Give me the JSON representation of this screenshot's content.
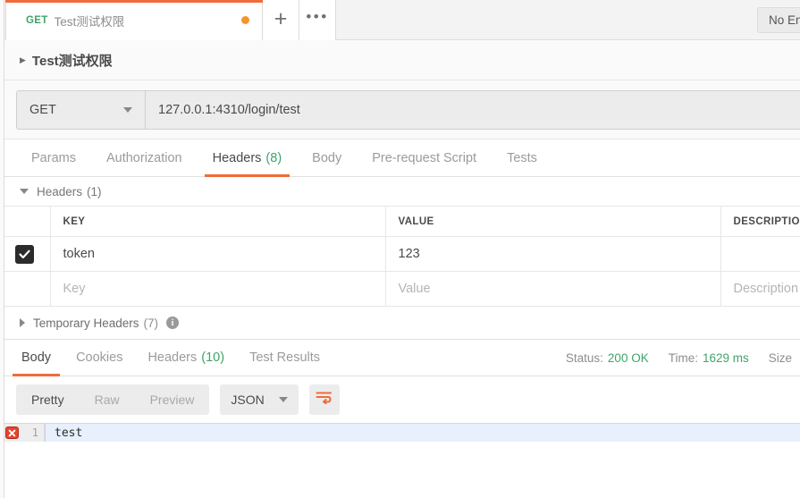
{
  "tabstrip": {
    "tab": {
      "method": "GET",
      "title": "Test测试权限",
      "unsaved_dot": "unsaved-indicator"
    },
    "new_tab_label": "+",
    "more_label": "•••",
    "environment": "No Environment"
  },
  "breadcrumb": {
    "caret": "▶",
    "title": "Test测试权限"
  },
  "request": {
    "method": "GET",
    "url": "127.0.0.1:4310/login/test",
    "tabs": [
      {
        "label": "Params",
        "count": "",
        "active": false
      },
      {
        "label": "Authorization",
        "count": "",
        "active": false
      },
      {
        "label": "Headers",
        "count": "(8)",
        "active": true
      },
      {
        "label": "Body",
        "count": "",
        "active": false
      },
      {
        "label": "Pre-request Script",
        "count": "",
        "active": false
      },
      {
        "label": "Tests",
        "count": "",
        "active": false
      }
    ]
  },
  "headers_section": {
    "title": "Headers",
    "count": "(1)",
    "columns": [
      "KEY",
      "VALUE",
      "DESCRIPTION"
    ],
    "rows": [
      {
        "checked": true,
        "key": "token",
        "value": "123",
        "description": ""
      }
    ],
    "placeholder_row": {
      "key": "Key",
      "value": "Value",
      "description": "Description"
    },
    "temporary": {
      "title": "Temporary Headers",
      "count": "(7)",
      "info": "i"
    }
  },
  "response": {
    "tabs": [
      {
        "label": "Body",
        "count": "",
        "active": true
      },
      {
        "label": "Cookies",
        "count": "",
        "active": false
      },
      {
        "label": "Headers",
        "count": "(10)",
        "active": false
      },
      {
        "label": "Test Results",
        "count": "",
        "active": false
      }
    ],
    "status": {
      "status_label": "Status:",
      "status_value": "200 OK",
      "time_label": "Time:",
      "time_value": "1629 ms",
      "size_label": "Size"
    },
    "view_modes": [
      {
        "label": "Pretty",
        "active": true
      },
      {
        "label": "Raw",
        "active": false
      },
      {
        "label": "Preview",
        "active": false
      }
    ],
    "language": "JSON",
    "wrap_icon": "word-wrap-icon",
    "body": {
      "lines": [
        {
          "number": "1",
          "text": "test",
          "error": true
        }
      ]
    }
  },
  "colors": {
    "accent": "#f26b3a",
    "success": "#3fa46a",
    "unsaved": "#f6952f",
    "error": "#e8422e",
    "active_line": "#e8f0fd"
  }
}
